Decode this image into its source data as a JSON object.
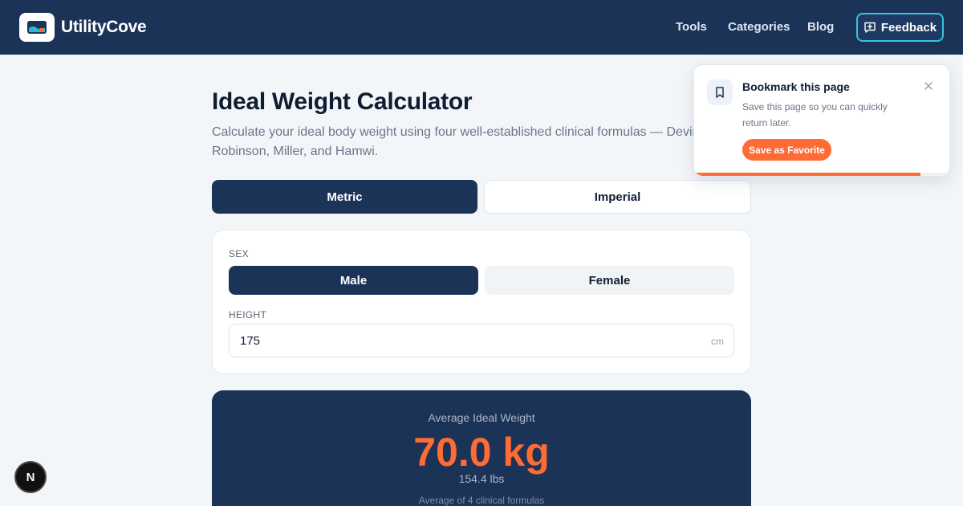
{
  "header": {
    "brand": "UtilityCove",
    "nav": [
      "Tools",
      "Categories",
      "Blog"
    ],
    "feedback_label": "Feedback",
    "background_color": "#1c3358",
    "feedback_border_color": "#38c3e0"
  },
  "main": {
    "title": "Ideal Weight Calculator",
    "subtitle": "Calculate your ideal body weight using four well-established clinical formulas — Devine, Robinson, Miller, and Hamwi.",
    "unit_toggle": {
      "options": [
        "Metric",
        "Imperial"
      ],
      "selected": "Metric"
    },
    "form": {
      "sex_label": "SEX",
      "sex_options": [
        "Male",
        "Female"
      ],
      "sex_selected": "Male",
      "height_label": "HEIGHT",
      "height_value": "175",
      "height_unit": "cm"
    },
    "result": {
      "label": "Average Ideal Weight",
      "value": "70.0 kg",
      "imperial": "154.4 lbs",
      "note": "Average of 4 clinical formulas",
      "accent_color": "#ff6b35"
    }
  },
  "bookmark_popup": {
    "title": "Bookmark this page",
    "description": "Save this page so you can quickly return later.",
    "button_label": "Save as Favorite",
    "progress_fraction": 0.88,
    "icon": "bookmark-icon"
  },
  "dev_badge": {
    "label": "N"
  }
}
